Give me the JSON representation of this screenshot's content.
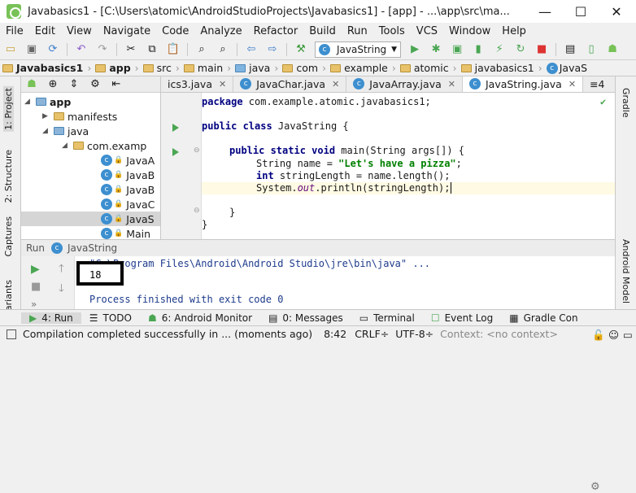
{
  "window": {
    "title": "Javabasics1 - [C:\\Users\\atomic\\AndroidStudioProjects\\Javabasics1] - [app] - ...\\app\\src\\ma...",
    "minimize": "—",
    "maximize": "☐",
    "close": "✕"
  },
  "menu": [
    "File",
    "Edit",
    "View",
    "Navigate",
    "Code",
    "Analyze",
    "Refactor",
    "Build",
    "Run",
    "Tools",
    "VCS",
    "Window",
    "Help"
  ],
  "toolbar": {
    "run_config": "JavaString"
  },
  "breadcrumb": [
    "Javabasics1",
    "app",
    "src",
    "main",
    "java",
    "com",
    "example",
    "atomic",
    "javabasics1",
    "JavaS"
  ],
  "left_tools": {
    "project": "1: Project",
    "structure": "2: Structure",
    "captures": "Captures",
    "variants": "Variants"
  },
  "right_tools": {
    "gradle": "Gradle",
    "android_model": "Android Model"
  },
  "project_tree": {
    "app": "app",
    "manifests": "manifests",
    "java": "java",
    "package": "com.examp",
    "classes": [
      "JavaA",
      "JavaB",
      "JavaB",
      "JavaC",
      "JavaS",
      "Main"
    ]
  },
  "tabs": [
    {
      "label": "ics3.java",
      "active": false
    },
    {
      "label": "JavaChar.java",
      "active": false
    },
    {
      "label": "JavaArray.java",
      "active": false
    },
    {
      "label": "JavaString.java",
      "active": true
    }
  ],
  "tab_overflow": "≡4",
  "code": {
    "package_kw": "package",
    "package_name": " com.example.atomic.javabasics1;",
    "class_kw": "public class",
    "class_name": " JavaString {",
    "main_kw": "public static void",
    "main_rest": " main(String args[]) {",
    "l1_a": "String name = ",
    "l1_str": "\"Let's have a pizza\"",
    "l1_b": ";",
    "l2_kw": "int",
    "l2_rest": " stringLength = name.length();",
    "l3_a": "System.",
    "l3_fld": "out",
    "l3_b": ".println(stringLength);",
    "close_inner": "}",
    "close_outer": "}"
  },
  "run_panel": {
    "label": "Run",
    "config": "JavaString",
    "cmd": "\"C:\\Program Files\\Android\\Android Studio\\jre\\bin\\java\" ...",
    "output": "18",
    "finished": "Process finished with exit code 0"
  },
  "bottom_tabs": [
    "4: Run",
    "TODO",
    "6: Android Monitor",
    "0: Messages",
    "Terminal",
    "Event Log",
    "Gradle Con"
  ],
  "status": {
    "message": "Compilation completed successfully in ... (moments ago)",
    "position": "8:42",
    "line_sep": "CRLF÷",
    "encoding": "UTF-8÷",
    "context": "Context: <no context>"
  }
}
